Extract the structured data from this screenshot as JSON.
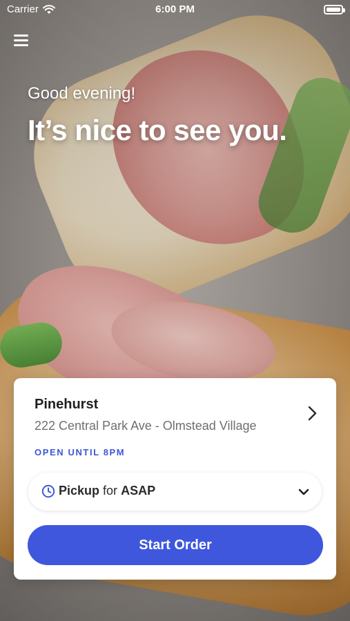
{
  "status_bar": {
    "carrier": "Carrier",
    "time": "6:00 PM"
  },
  "header": {
    "greeting": "Good evening!",
    "headline": "It’s nice to see you."
  },
  "location": {
    "name": "Pinehurst",
    "address": "222 Central Park Ave - Olmstead Village",
    "hours_status": "OPEN UNTIL 8PM"
  },
  "order_mode": {
    "mode": "Pickup",
    "connector": "for",
    "time": "ASAP"
  },
  "actions": {
    "start_order_label": "Start Order"
  },
  "colors": {
    "accent": "#3e57dc",
    "hours_status": "#3f55d8"
  },
  "icons": {
    "menu": "hamburger-icon",
    "chevron_right": "chevron-right-icon",
    "clock": "clock-icon",
    "chevron_down": "chevron-down-icon",
    "wifi": "wifi-icon",
    "battery": "battery-icon"
  }
}
